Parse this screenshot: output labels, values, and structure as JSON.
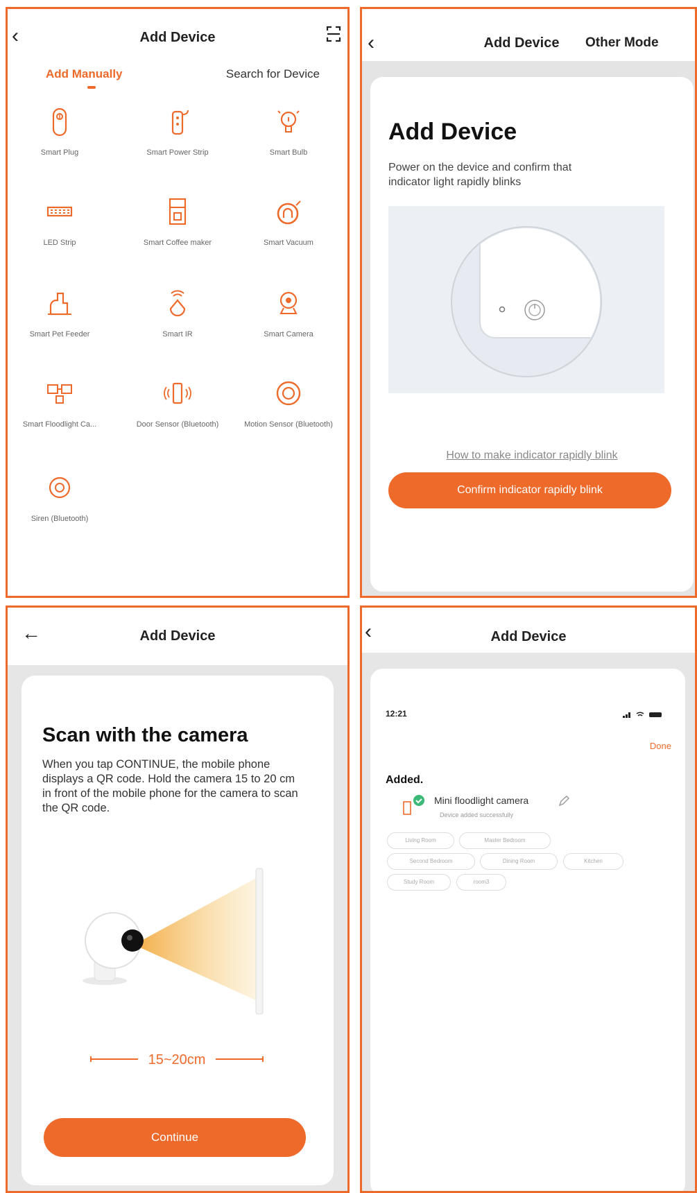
{
  "panel1": {
    "back_icon": "chevron-left",
    "title": "Add Device",
    "scan_icon": "scan",
    "tabs": {
      "manual": "Add Manually",
      "search": "Search for Device"
    },
    "devices": [
      {
        "label": "Smart Plug",
        "icon": "plug"
      },
      {
        "label": "Smart Power Strip",
        "icon": "power-strip"
      },
      {
        "label": "Smart Bulb",
        "icon": "bulb"
      },
      {
        "label": "LED Strip",
        "icon": "led-strip"
      },
      {
        "label": "Smart Coffee maker",
        "icon": "coffee-maker"
      },
      {
        "label": "Smart Vacuum",
        "icon": "vacuum"
      },
      {
        "label": "Smart Pet Feeder",
        "icon": "pet-feeder"
      },
      {
        "label": "Smart IR",
        "icon": "ir"
      },
      {
        "label": "Smart Camera",
        "icon": "camera"
      },
      {
        "label": "Smart Floodlight Ca...",
        "icon": "floodlight"
      },
      {
        "label": "Door Sensor (Bluetooth)",
        "icon": "door-sensor"
      },
      {
        "label": "Motion Sensor (Bluetooth)",
        "icon": "motion-sensor"
      },
      {
        "label": "Siren (Bluetooth)",
        "icon": "siren"
      }
    ]
  },
  "panel2": {
    "back_icon": "chevron-left",
    "title": "Add Device",
    "other_mode": "Other Mode",
    "heading": "Add Device",
    "description": "Power on the device and confirm that indicator light rapidly blinks",
    "howto_link": "How to make indicator rapidly blink",
    "confirm_button": "Confirm indicator rapidly blink"
  },
  "panel3": {
    "back_icon": "arrow-left",
    "title": "Add Device",
    "heading": "Scan with the camera",
    "description": "When you tap CONTINUE, the mobile phone displays a QR code. Hold the camera 15 to 20 cm in front of the mobile phone for the camera to scan the QR code.",
    "distance": "15~20cm",
    "continue_button": "Continue"
  },
  "panel4": {
    "back_icon": "chevron-left",
    "title": "Add Device",
    "time": "12:21",
    "done": "Done",
    "added": "Added.",
    "device_name": "Mini floodlight camera",
    "device_status": "Device added successfully",
    "rooms": [
      "Living Room",
      "Master Bedroom",
      "Second Bedroom",
      "Dining Room",
      "Kitchen",
      "Study Room",
      "room3"
    ]
  },
  "colors": {
    "accent": "#ee6a2b",
    "frame": "#ee6a2b",
    "success": "#3cb878"
  }
}
